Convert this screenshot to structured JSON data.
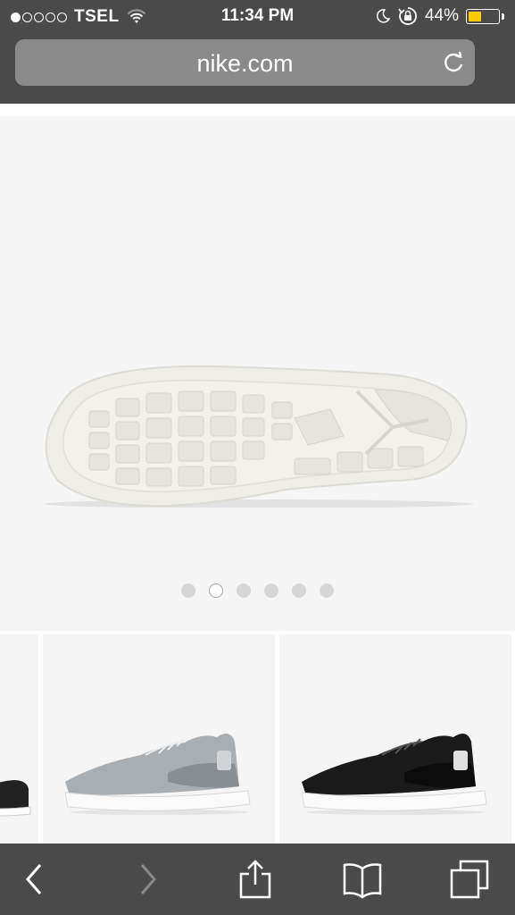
{
  "status_bar": {
    "signal_bars": [
      true,
      false,
      false,
      false,
      false
    ],
    "carrier": "TSEL",
    "time": "11:34 PM",
    "battery_text": "44%",
    "battery_level": 0.44,
    "battery_color": "#ffcc00",
    "icons": [
      "wifi-icon",
      "moon-icon",
      "rotation-lock-icon",
      "battery-icon"
    ]
  },
  "browser": {
    "url": "nike.com",
    "reload_icon": "reload-icon"
  },
  "gallery": {
    "image": "shoe-sole-image",
    "pager_count": 6,
    "active_index": 1
  },
  "thumbnails": [
    {
      "name": "thumbnail-partial",
      "color": "black-white"
    },
    {
      "name": "thumbnail-grey",
      "color": "grey-white"
    },
    {
      "name": "thumbnail-black",
      "color": "black-white"
    }
  ],
  "toolbar": {
    "buttons": [
      "back-icon",
      "forward-icon",
      "share-icon",
      "bookmarks-icon",
      "tabs-icon"
    ]
  }
}
